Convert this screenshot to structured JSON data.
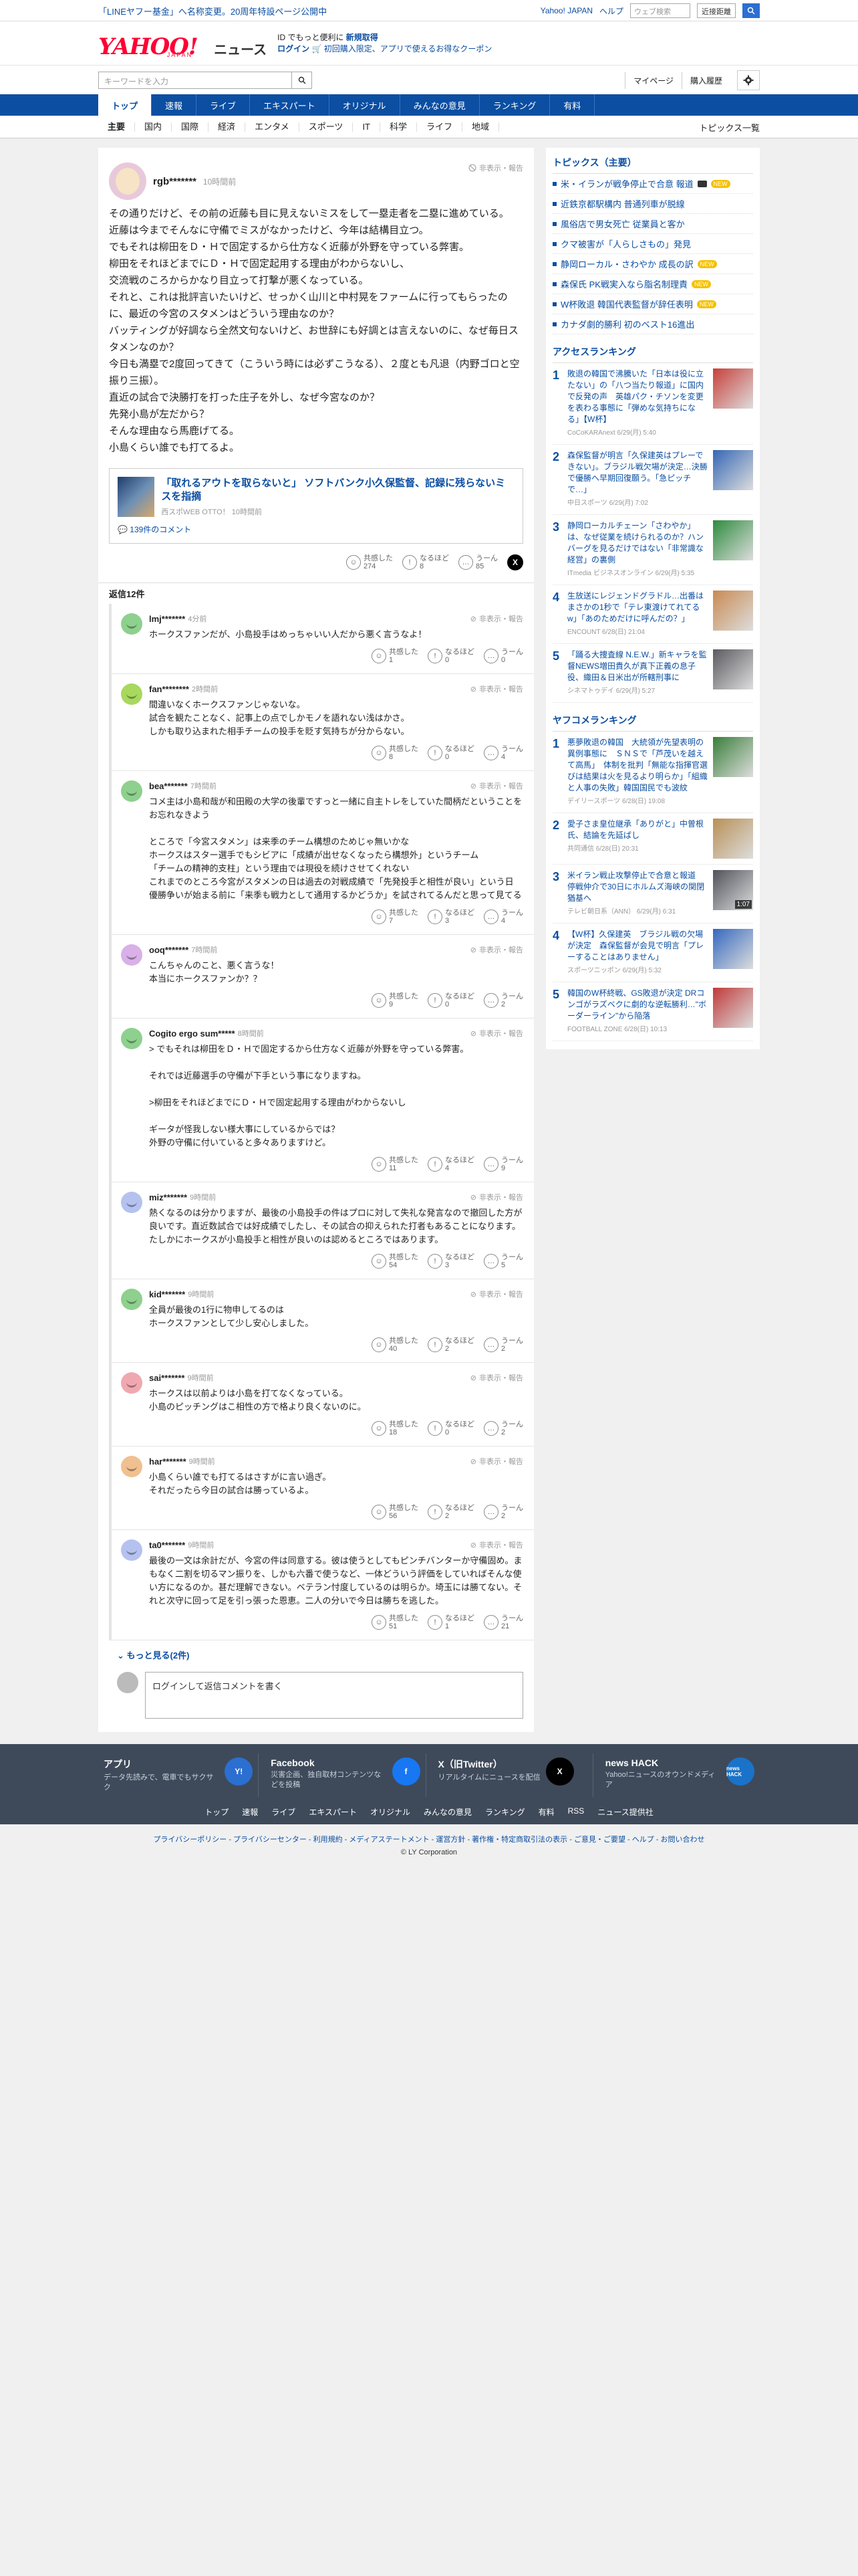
{
  "topstrip": {
    "notice": "「LINEヤフー基金」へ名称変更。20周年特設ページ公開中",
    "yahoo_japan": "Yahoo! JAPAN",
    "help": "ヘルプ",
    "search_placeholder": "ウェブ検索",
    "search_select": "近接距離"
  },
  "header": {
    "logo_main": "YAHOO!",
    "logo_sub": "JAPAN",
    "logo_news": "ニュース",
    "promo_line1_a": "ID でもっと便利に",
    "promo_line1_b": "新規取得",
    "promo_line2_a": "ログイン",
    "promo_line2_b": "🛒 初回購入限定、アプリで使えるお得なクーポン"
  },
  "search": {
    "placeholder": "キーワードを入力",
    "mypage": "マイページ",
    "purchase": "購入履歴"
  },
  "bluenav": [
    "トップ",
    "速報",
    "ライブ",
    "エキスパート",
    "オリジナル",
    "みんなの意見",
    "ランキング",
    "有料"
  ],
  "catnav": [
    "主要",
    "国内",
    "国際",
    "経済",
    "エンタメ",
    "スポーツ",
    "IT",
    "科学",
    "ライフ",
    "地域"
  ],
  "catnav_topics": "トピックス一覧",
  "post": {
    "user": "rgb*******",
    "time": "10時間前",
    "report": "非表示・報告",
    "text": "その通りだけど、その前の近藤も目に見えないミスをして一塁走者を二塁に進めている。\n近藤は今までそんなに守備でミスがなかったけど、今年は結構目立つ。\nでもそれは柳田をＤ・Ｈで固定するから仕方なく近藤が外野を守っている弊害。\n柳田をそれほどまでにＤ・Ｈで固定起用する理由がわからないし、\n交流戦のころからかなり目立って打撃が悪くなっている。\nそれと、これは批評言いたいけど、せっかく山川と中村晃をファームに行ってもらったのに、最近の今宮のスタメンはどういう理由なのか？\nバッティングが好調なら全然文句ないけど、お世辞にも好調とは言えないのに、なぜ毎日スタメンなのか？\n今日も満塁で2度回ってきて（こういう時には必ずこうなる）、２度とも凡退（内野ゴロと空振り三振）。\n直近の試合で決勝打を打った庄子を外し、なぜ今宮なのか？\n先発小島が左だから？\nそんな理由なら馬鹿げてる。\n小島くらい誰でも打てるよ。",
    "article_title": "「取れるアウトを取らないと」 ソフトバンク小久保監督、記録に残らないミスを指摘",
    "article_source": "西スポWEB OTTO！ 10時間前",
    "article_comments": "139件のコメント",
    "reactions": {
      "agree_label": "共感した",
      "agree": "274",
      "insight_label": "なるほど",
      "insight": "8",
      "hmm_label": "うーん",
      "hmm": "85"
    }
  },
  "replies_label": "返信12件",
  "replies": [
    {
      "user": "lmj*******",
      "time": "4分前",
      "color": "#8ed08e",
      "text": "ホークスファンだが、小島投手はめっちゃいい人だから悪く言うなよ！",
      "agree": "1",
      "insight": "0",
      "hmm": "0"
    },
    {
      "user": "fan********",
      "time": "2時間前",
      "color": "#a8d85e",
      "text": "間違いなくホークスファンじゃないな。\n試合を観たことなく、記事上の点でしかモノを語れない浅はかさ。\nしかも取り込まれた相手チームの投手を貶す気持ちが分からない。",
      "agree": "8",
      "insight": "0",
      "hmm": "4"
    },
    {
      "user": "bea*******",
      "time": "7時間前",
      "color": "#8ed08e",
      "text": "コメ主は小島和哉が和田殿の大学の後輩ですっと一緒に自主トレをしていた間柄だということをお忘れなきよう\n\nところで「今宮スタメン」は来季のチーム構想のためじゃ無いかな\nホークスはスター選手でもシビアに「成績が出せなくなったら構想外」というチーム\n「チームの精神的支柱」という理由では現役を続けさせてくれない\nこれまでのところ今宮がスタメンの日は過去の対戦成績で「先発投手と相性が良い」という日\n優勝争いが始まる前に「来季も戦力として通用するかどうか」を試されてるんだと思って見てる",
      "agree": "7",
      "insight": "3",
      "hmm": "4"
    },
    {
      "user": "ooq*******",
      "time": "7時間前",
      "color": "#d9b0e8",
      "text": "こんちゃんのこと、悪く言うな！\n本当にホークスファンか？？",
      "agree": "9",
      "insight": "0",
      "hmm": "2"
    },
    {
      "user": "Cogito ergo sum*****",
      "time": "8時間前",
      "color": "#8ed08e",
      "text": "> でもそれは柳田をＤ・Ｈで固定するから仕方なく近藤が外野を守っている弊害。\n\nそれでは近藤選手の守備が下手という事になりますね。\n\n>柳田をそれほどまでにＤ・Ｈで固定起用する理由がわからないし\n\nギータが怪我しない様大事にしているからでは？\n外野の守備に付いていると多々ありますけど。",
      "agree": "11",
      "insight": "4",
      "hmm": "9"
    },
    {
      "user": "miz*******",
      "time": "9時間前",
      "color": "#b5c2f0",
      "text": "熱くなるのは分かりますが、最後の小島投手の件はプロに対して失礼な発言なので撤回した方が良いです。直近数試合では好成績でしたし、その試合の抑えられた打者もあることになります。たしかにホークスが小島投手と相性が良いのは認めるところではあります。",
      "agree": "54",
      "insight": "3",
      "hmm": "5"
    },
    {
      "user": "kid*******",
      "time": "9時間前",
      "color": "#8ed08e",
      "text": "全員が最後の1行に物申してるのは\nホークスファンとして少し安心しました。",
      "agree": "40",
      "insight": "2",
      "hmm": "2"
    },
    {
      "user": "sai*******",
      "time": "9時間前",
      "color": "#f0a8b0",
      "text": "ホークスは以前よりは小島を打てなくなっている。\n小島のピッチングはこ相性の方で格より良くないのに。",
      "agree": "18",
      "insight": "0",
      "hmm": "2"
    },
    {
      "user": "har*******",
      "time": "9時間前",
      "color": "#f0c090",
      "text": "小島くらい誰でも打てるはさすがに言い過ぎ。\nそれだったら今日の試合は勝っているよ。",
      "agree": "56",
      "insight": "2",
      "hmm": "2"
    },
    {
      "user": "ta0*******",
      "time": "9時間前",
      "color": "#b5c2f0",
      "text": "最後の一文は余計だが、今宮の件は同意する。彼は使うとしてもピンチバンターか守備固め。まもなく二割を切るマン振りを、しかも六番で使うなど、一体どういう評価をしていればそんな使い方になるのか。甚だ理解できない。ベテラン忖度しているのは明らか。埼玉には勝てない。それと次守に回って足を引っ張った恩恵。二人の分いで今日は勝ちを逃した。",
      "agree": "51",
      "insight": "1",
      "hmm": "21"
    }
  ],
  "more_replies": "もっと見る(2件)",
  "login_comment": "ログインして返信コメントを書く",
  "side": {
    "topics_title": "トピックス（主要）",
    "topics": [
      {
        "text": "米・イランが戦争停止で合意 報道",
        "badge": "NEW"
      },
      {
        "text": "近鉄京都駅構内 普通列車が脱線",
        "badge": ""
      },
      {
        "text": "風俗店で男女死亡 従業員と客か",
        "badge": ""
      },
      {
        "text": "クマ被害が「人らしさもの」発見",
        "badge": ""
      },
      {
        "text": "静岡ローカル・さわやか 成長の訳",
        "badge": "NEW"
      },
      {
        "text": "森保氏 PK戦実入なら脂名制理責",
        "badge": "NEW"
      },
      {
        "text": "W杯敗退 韓国代表監督が辞任表明",
        "badge": "NEW"
      },
      {
        "text": "カナダ劇的勝利 初のベスト16進出",
        "badge": ""
      }
    ],
    "access_title": "アクセスランキング",
    "access": [
      {
        "n": "1",
        "text": "敗退の韓国で沸騰いた「日本は役に立たない」の「八つ当たり報道」に国内で反発の声　英雄パク・チソンを変更を表わる事態に「弾めな気持ちになる」【W杯】",
        "src": "CoCoKARAnext 6/29(月) 5:40",
        "img": "#c8403a"
      },
      {
        "n": "2",
        "text": "森保監督が明言「久保建英はプレーできない」。ブラジル戦欠場が決定…決勝で優勝へ早期回復願う。「急ピッチで…」",
        "src": "中日スポーツ 6/29(月) 7:02",
        "img": "#3566b5"
      },
      {
        "n": "3",
        "text": "静岡ローカルチェーン「さわやか」は、なぜ従業を続けられるのか？ハンバーグを見るだけではない「非常識な経営」の裏側",
        "src": "ITmedia ビジネスオンライン 6/29(月) 5:35",
        "img": "#2e8b3e"
      },
      {
        "n": "4",
        "text": "生放送にレジェンドグラドル…出番はまさかの1秒で「テレ東渡けてれてるw」「あのためだけに呼んだの？」",
        "src": "ENCOUNT 6/28(日) 21:04",
        "img": "#c98a52"
      },
      {
        "n": "5",
        "text": "「踊る大捜査線 N.E.W.」新キャラを監督NEWS増田貴久が真下正義の息子役、織田＆日米出が所轄刑事に",
        "src": "シネマトゥデイ 6/29(月) 5:27",
        "img": "#5a5a60"
      }
    ],
    "yafoo_title": "ヤフコメランキング",
    "yafoo": [
      {
        "n": "1",
        "text": "悪夢敗退の韓国　大統領が先望表明の異例事態に　ＳＮＳで「芦茂いを越えて高馬」　体制を批判「無能な指揮官選びは結果は火を見るより明らか」「組織と人事の失敗」韓国国民でも波紋",
        "src": "デイリースポーツ 6/28(日) 19:08",
        "img": "#3a7e3a",
        "dur": ""
      },
      {
        "n": "2",
        "text": "愛子さま皇位継承「ありがと」中曽根氏、結論を先延ばし",
        "src": "共同通信 6/28(日) 20:31",
        "img": "#b89056",
        "dur": ""
      },
      {
        "n": "3",
        "text": "米イラン戦止攻撃停止で合意と報道　停戦仲介で30日にホルムズ海峡の関閉猶基へ",
        "src": "テレビ朝日系（ANN） 6/29(月) 6:31",
        "img": "#50525a",
        "dur": "1:07"
      },
      {
        "n": "4",
        "text": "【W杯】久保建英　ブラジル戦の欠場が決定　森保監督が会見で明言「プレーすることはありません」",
        "src": "スポーツニッポン 6/29(月) 5:32",
        "img": "#3568c0",
        "dur": ""
      },
      {
        "n": "5",
        "text": "韓国のW杯終戦、GS敗退が決定 DRコンゴがラズベクに劇的な逆転勝利…\"ボーダーライン\"から陥落",
        "src": "FOOTBALL ZONE 6/28(日) 10:13",
        "img": "#c03a3a",
        "dur": ""
      }
    ]
  },
  "footer": {
    "apps": [
      {
        "title": "アプリ",
        "desc": "データ先読みで、電車でもサクサク",
        "icon": "Y!",
        "color": "#2b6fd1"
      },
      {
        "title": "Facebook",
        "desc": "災害企画、独自取材コンテンツなどを投稿",
        "icon": "f",
        "color": "#1877f2"
      },
      {
        "title": "X（旧Twitter）",
        "desc": "リアルタイムにニュースを配信",
        "icon": "X",
        "color": "#000000"
      },
      {
        "title": "news HACK",
        "desc": "Yahoo!ニュースのオウンドメディア",
        "icon": "news HACK",
        "color": "#1a73c8"
      }
    ],
    "links": [
      "トップ",
      "速報",
      "ライブ",
      "エキスパート",
      "オリジナル",
      "みんなの意見",
      "ランキング",
      "有料",
      "RSS",
      "ニュース提供社"
    ],
    "legal": "プライバシーポリシー - プライバシーセンター - 利用規約 - メディアステートメント - 運営方針 - 著作権・特定商取引法の表示 - ご意見・ご要望 - ヘルプ - お問い合わせ",
    "copyright": "© LY Corporation"
  }
}
